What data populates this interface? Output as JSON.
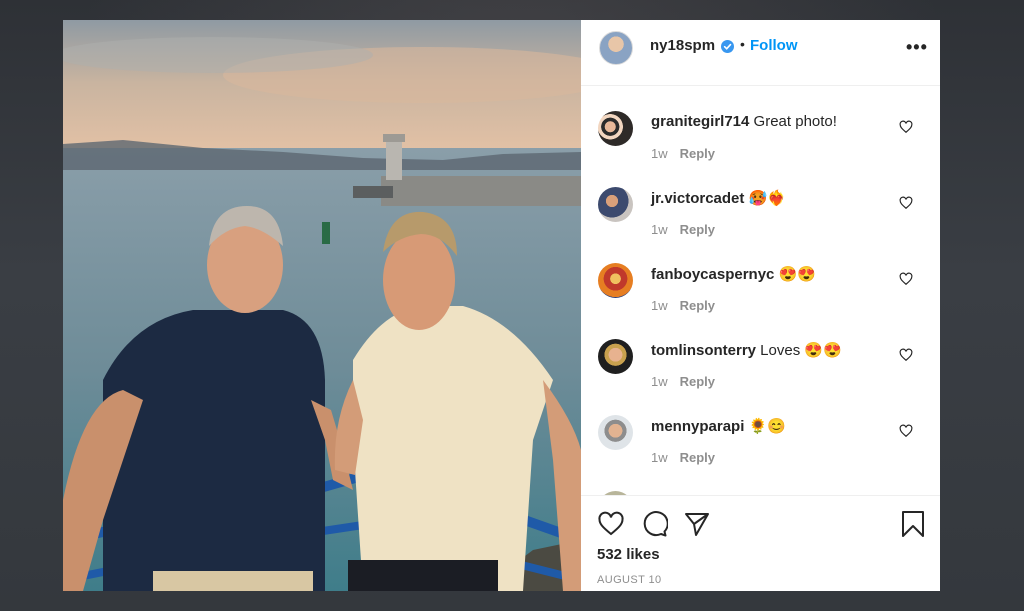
{
  "post": {
    "username": "ny18spm",
    "verified": true,
    "follow_label": "Follow",
    "separator": "•",
    "more_label": "•••",
    "likes": "532 likes",
    "date": "AUGUST 10"
  },
  "comments": [
    {
      "username": "granitegirl714",
      "text": " Great photo!",
      "age": "1w",
      "reply": "Reply"
    },
    {
      "username": "jr.victorcadet",
      "text": " 🥵❤️‍🔥",
      "age": "1w",
      "reply": "Reply"
    },
    {
      "username": "fanboycaspernyc",
      "text": " 😍😍",
      "age": "1w",
      "reply": "Reply"
    },
    {
      "username": "tomlinsonterry",
      "text": " Loves 😍😍",
      "age": "1w",
      "reply": "Reply"
    },
    {
      "username": "mennyparapi",
      "text": " 🌻😊",
      "age": "1w",
      "reply": "Reply"
    }
  ],
  "colors": {
    "link": "#0095f6",
    "text": "#262626",
    "muted": "#8e8e8e"
  },
  "icons": [
    "heart-icon",
    "comment-icon",
    "share-icon",
    "bookmark-icon",
    "verified-icon",
    "more-icon"
  ]
}
